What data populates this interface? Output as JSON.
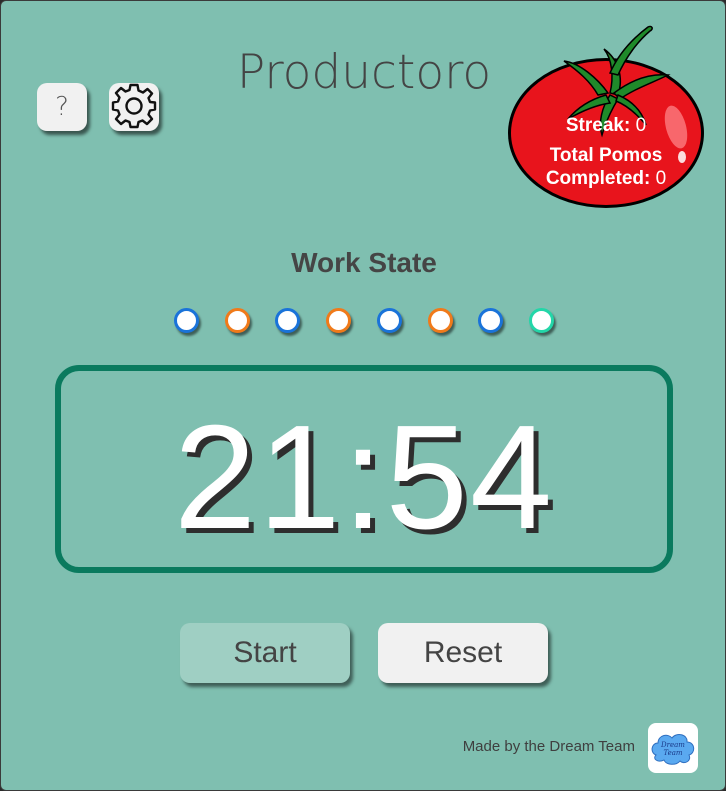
{
  "header": {
    "title": "Productoro"
  },
  "toolbar": {
    "help_label": "?",
    "settings_icon": "gear-icon"
  },
  "stats": {
    "streak_label": "Streak:",
    "streak_value": "0",
    "total_label_line1": "Total Pomos",
    "total_label_line2": "Completed:",
    "total_value": "0"
  },
  "state": {
    "label": "Work State"
  },
  "progress_dots": [
    {
      "color": "#1a73d9"
    },
    {
      "color": "#f07a1a"
    },
    {
      "color": "#1a73d9"
    },
    {
      "color": "#f07a1a"
    },
    {
      "color": "#1a73d9"
    },
    {
      "color": "#f07a1a"
    },
    {
      "color": "#1a73d9"
    },
    {
      "color": "#23d6a8"
    }
  ],
  "timer": {
    "display": "21:54"
  },
  "controls": {
    "start_label": "Start",
    "reset_label": "Reset"
  },
  "footer": {
    "credit": "Made by the Dream Team",
    "logo_text_1": "Dream",
    "logo_text_2": "Team"
  },
  "colors": {
    "background": "#7fbfb0",
    "timer_border": "#0a7a5e",
    "tomato_red": "#e8141c"
  }
}
